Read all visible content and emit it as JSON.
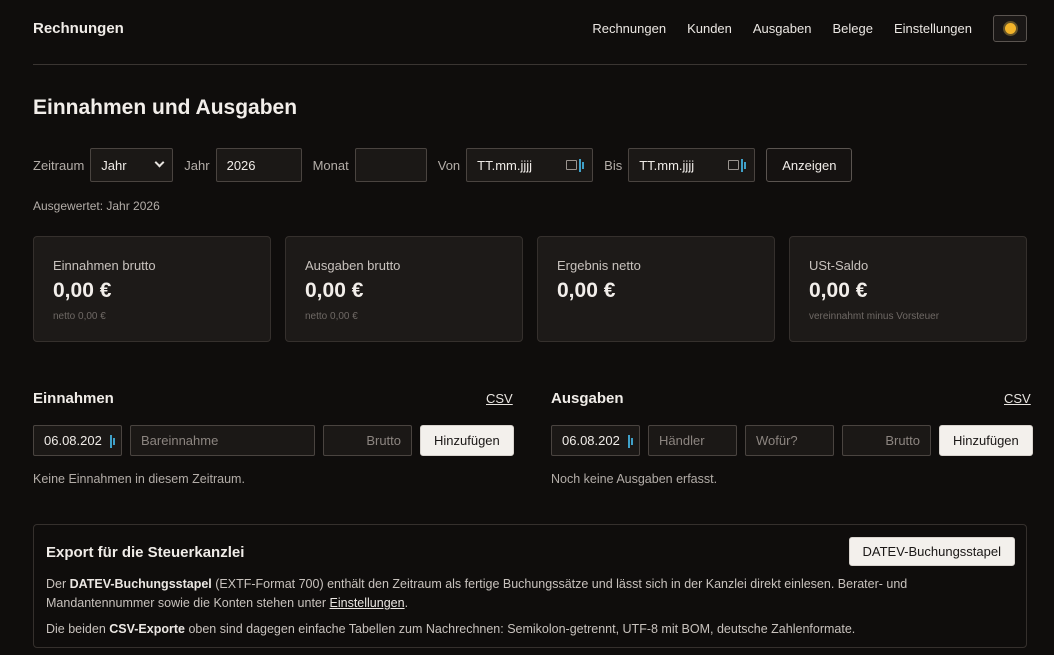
{
  "header": {
    "brand": "Rechnungen",
    "nav": [
      "Rechnungen",
      "Kunden",
      "Ausgaben",
      "Belege",
      "Einstellungen"
    ]
  },
  "page": {
    "title": "Einnahmen und Ausgaben"
  },
  "filters": {
    "zeitraum_label": "Zeitraum",
    "zeitraum_value": "Jahr",
    "jahr_label": "Jahr",
    "jahr_value": "2026",
    "monat_label": "Monat",
    "monat_value": "",
    "von_label": "Von",
    "von_placeholder": "TT.mm.jjjj",
    "bis_label": "Bis",
    "bis_placeholder": "TT.mm.jjjj",
    "submit": "Anzeigen"
  },
  "evaluated": "Ausgewertet: Jahr 2026",
  "cards": [
    {
      "label": "Einnahmen brutto",
      "value": "0,00 €",
      "sub": "netto 0,00 €"
    },
    {
      "label": "Ausgaben brutto",
      "value": "0,00 €",
      "sub": "netto 0,00 €"
    },
    {
      "label": "Ergebnis netto",
      "value": "0,00 €",
      "sub": ""
    },
    {
      "label": "USt-Saldo",
      "value": "0,00 €",
      "sub": "vereinnahmt minus Vorsteuer"
    }
  ],
  "income": {
    "title": "Einnahmen",
    "csv": "CSV",
    "date": "06.08.202",
    "desc_placeholder": "Bareinnahme",
    "gross_placeholder": "Brutto",
    "add": "Hinzufügen",
    "empty": "Keine Einnahmen in diesem Zeitraum."
  },
  "expenses": {
    "title": "Ausgaben",
    "csv": "CSV",
    "date": "06.08.202",
    "vendor_placeholder": "Händler",
    "purpose_placeholder": "Wofür?",
    "gross_placeholder": "Brutto",
    "add": "Hinzufügen",
    "empty": "Noch keine Ausgaben erfasst."
  },
  "export": {
    "title": "Export für die Steuerkanzlei",
    "button": "DATEV-Buchungsstapel",
    "p1_pre": "Der ",
    "p1_bold": "DATEV-Buchungsstapel",
    "p1_mid": " (EXTF-Format 700) enthält den Zeitraum als fertige Buchungssätze und lässt sich in der Kanzlei direkt einlesen. Berater- und Mandantennummer sowie die Konten stehen unter ",
    "p1_link": "Einstellungen",
    "p1_post": ".",
    "p2_pre": "Die beiden ",
    "p2_bold": "CSV-Exporte",
    "p2_post": " oben sind dagegen einfache Tabellen zum Nachrechnen: Semikolon-getrennt, UTF-8 mit BOM, deutsche Zahlenformate."
  },
  "colors": {
    "background": "#0f0d0c",
    "card": "#1d1a18",
    "accent_icon": "#3fa0c8",
    "sun": "#f2b32a"
  }
}
